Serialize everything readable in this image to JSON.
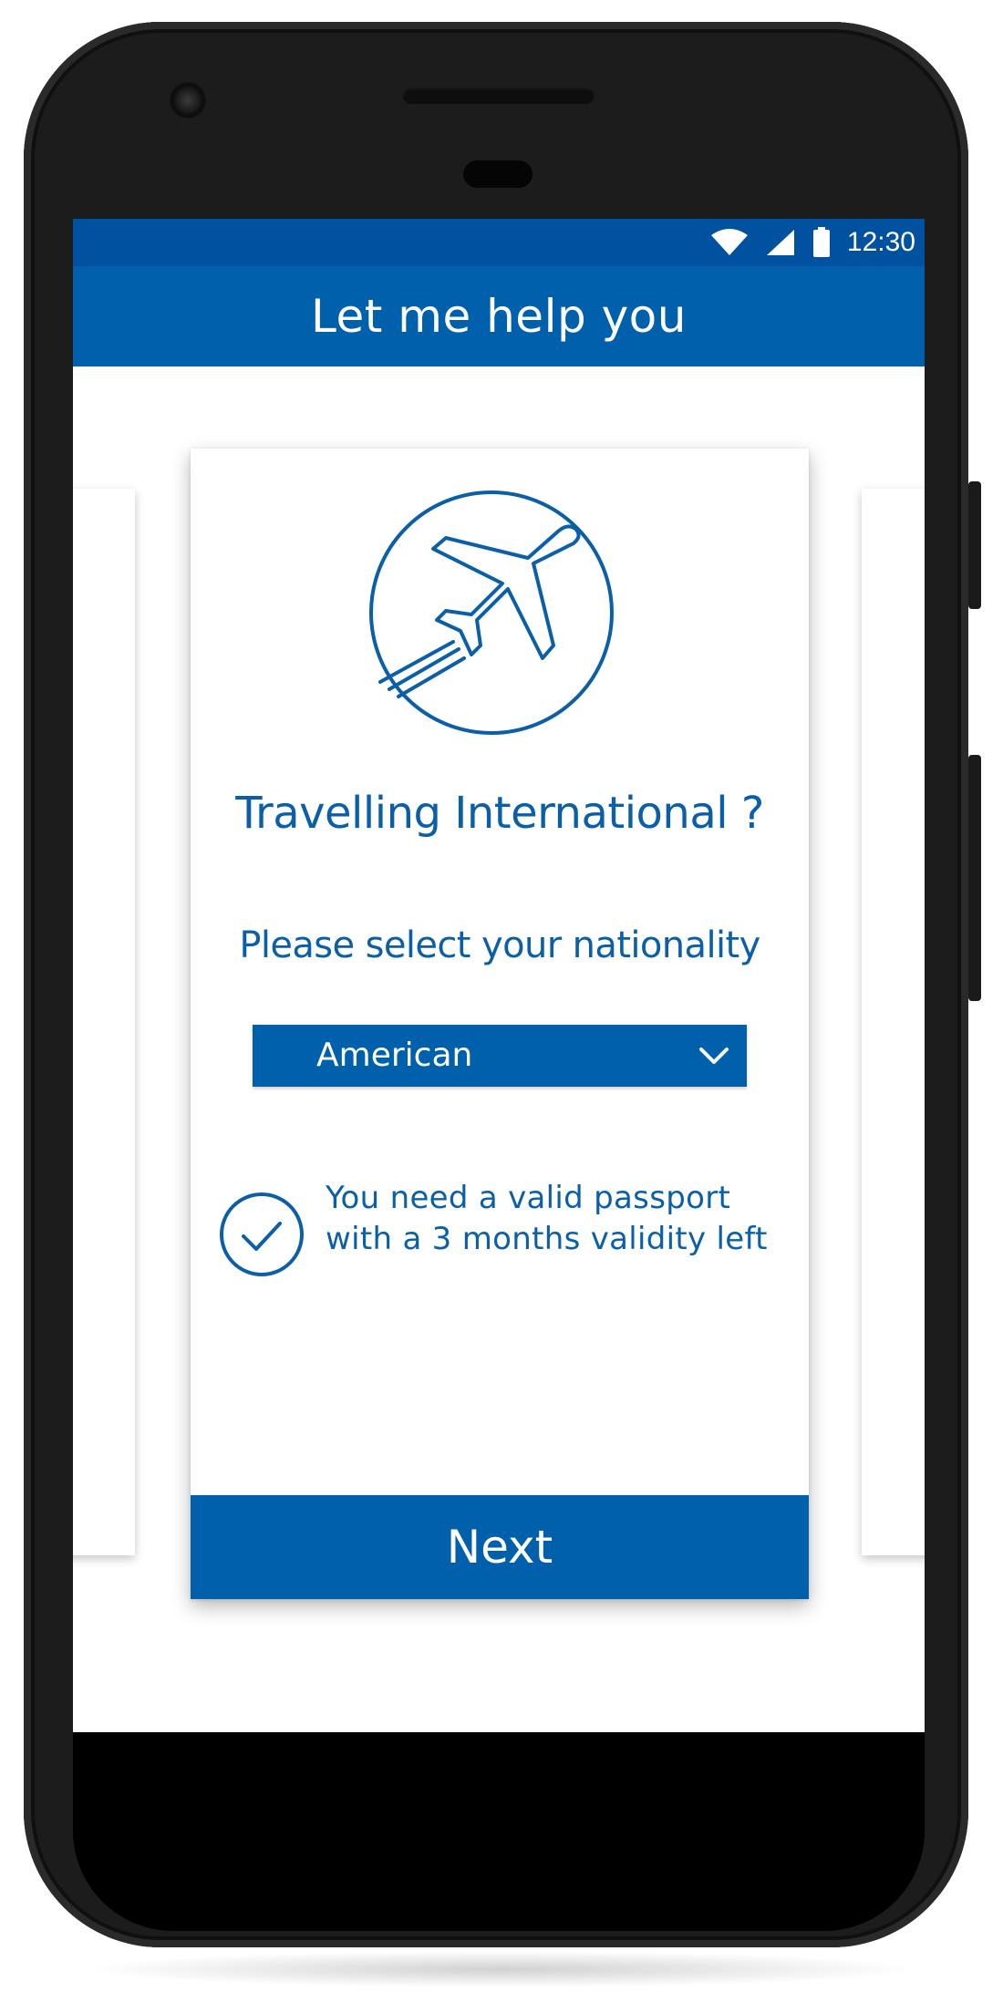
{
  "status_bar": {
    "time": "12:30",
    "icons": [
      "wifi-icon",
      "cellular-signal-icon",
      "battery-icon"
    ]
  },
  "app_bar": {
    "title": "Let me help you"
  },
  "card": {
    "emblem_icon": "airplane-takeoff-icon",
    "title": "Travelling International ?",
    "subtitle": "Please select your nationality",
    "nationality_select": {
      "value": "American",
      "icon": "chevron-down-icon"
    },
    "info": {
      "icon": "checkmark-circle-icon",
      "text": "You need a valid passport with a 3 months validity left"
    },
    "next_button": {
      "label": "Next"
    }
  },
  "colors": {
    "primary": "#0060ac",
    "status_bar": "#0052a0",
    "text_blue": "#0a5fa8",
    "phone_body": "#1c1c1c"
  }
}
